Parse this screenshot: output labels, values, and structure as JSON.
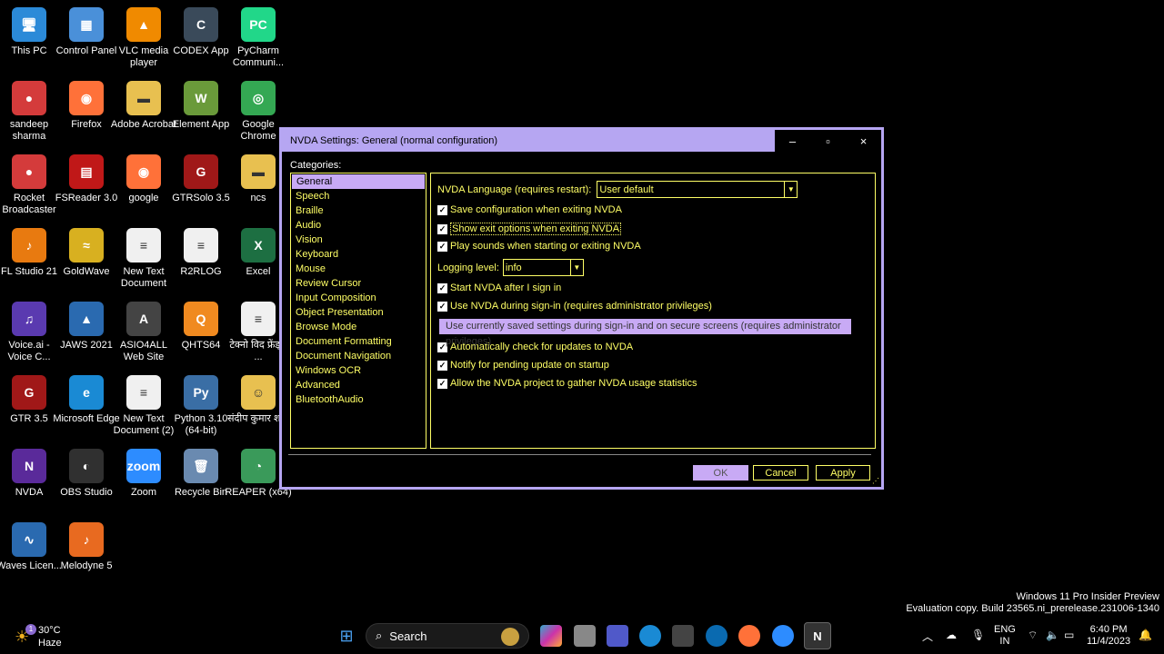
{
  "desktop": {
    "icons": [
      {
        "label": "This PC",
        "icon": "computer-icon",
        "color": "#2b8ad8",
        "glyph": "🖥"
      },
      {
        "label": "Control Panel",
        "icon": "control-panel-icon",
        "color": "#4a90d9",
        "glyph": "▦"
      },
      {
        "label": "VLC media player",
        "icon": "vlc-icon",
        "color": "#f08a00",
        "glyph": "▲"
      },
      {
        "label": "CODEX App",
        "icon": "codex-icon",
        "color": "#3a4a5a",
        "glyph": "C"
      },
      {
        "label": "PyCharm Communi...",
        "icon": "pycharm-icon",
        "color": "#21d789",
        "glyph": "PC"
      },
      {
        "label": "sandeep sharma",
        "icon": "microphone-icon",
        "color": "#d43b3b",
        "glyph": "●"
      },
      {
        "label": "Firefox",
        "icon": "firefox-icon",
        "color": "#ff7139",
        "glyph": "◉"
      },
      {
        "label": "Adobe Acrobat",
        "icon": "folder-icon",
        "color": "#e8c050",
        "glyph": "▬"
      },
      {
        "label": "Element App",
        "icon": "element-icon",
        "color": "#6a9a3a",
        "glyph": "W"
      },
      {
        "label": "Google Chrome",
        "icon": "chrome-icon",
        "color": "#34a853",
        "glyph": "◎"
      },
      {
        "label": "Rocket Broadcaster",
        "icon": "microphone-icon",
        "color": "#d43b3b",
        "glyph": "●"
      },
      {
        "label": "FSReader 3.0",
        "icon": "book-icon",
        "color": "#c01818",
        "glyph": "▤"
      },
      {
        "label": "google",
        "icon": "firefox-icon",
        "color": "#ff7139",
        "glyph": "◉"
      },
      {
        "label": "GTRSolo 3.5",
        "icon": "gtr-icon",
        "color": "#a01818",
        "glyph": "G"
      },
      {
        "label": "ncs",
        "icon": "folder-icon",
        "color": "#e8c050",
        "glyph": "▬"
      },
      {
        "label": "FL Studio 21",
        "icon": "fl-studio-icon",
        "color": "#e87a10",
        "glyph": "♪"
      },
      {
        "label": "GoldWave",
        "icon": "goldwave-icon",
        "color": "#d8b020",
        "glyph": "≈"
      },
      {
        "label": "New Text Document",
        "icon": "text-document-icon",
        "color": "#f0f0f0",
        "glyph": "≡"
      },
      {
        "label": "R2RLOG",
        "icon": "text-document-icon",
        "color": "#f0f0f0",
        "glyph": "≡"
      },
      {
        "label": "Excel",
        "icon": "excel-icon",
        "color": "#1d6f42",
        "glyph": "X"
      },
      {
        "label": "Voice.ai - Voice C...",
        "icon": "voice-ai-icon",
        "color": "#5a3ab0",
        "glyph": "♫"
      },
      {
        "label": "JAWS 2021",
        "icon": "jaws-icon",
        "color": "#2a6ab0",
        "glyph": "▲"
      },
      {
        "label": "ASIO4ALL Web Site",
        "icon": "asio-icon",
        "color": "#444",
        "glyph": "A"
      },
      {
        "label": "QHTS64",
        "icon": "qhts-icon",
        "color": "#f08a20",
        "glyph": "Q"
      },
      {
        "label": "टेक्नो विद फ्रेंड्स ...",
        "icon": "text-document-icon",
        "color": "#f0f0f0",
        "glyph": "≡"
      },
      {
        "label": "GTR 3.5",
        "icon": "gtr-icon",
        "color": "#a01818",
        "glyph": "G"
      },
      {
        "label": "Microsoft Edge",
        "icon": "edge-icon",
        "color": "#1a8ad4",
        "glyph": "e"
      },
      {
        "label": "New Text Document (2)",
        "icon": "text-document-icon",
        "color": "#f0f0f0",
        "glyph": "≡"
      },
      {
        "label": "Python 3.10 (64-bit)",
        "icon": "python-icon",
        "color": "#3a6ea5",
        "glyph": "Py"
      },
      {
        "label": "संदीप कुमार शर्मा",
        "icon": "user-folder-icon",
        "color": "#e8c050",
        "glyph": "☺"
      },
      {
        "label": "NVDA",
        "icon": "nvda-icon",
        "color": "#5a2a9a",
        "glyph": "N"
      },
      {
        "label": "OBS Studio",
        "icon": "obs-icon",
        "color": "#303030",
        "glyph": "◐"
      },
      {
        "label": "Zoom",
        "icon": "zoom-icon",
        "color": "#2d8cff",
        "glyph": "zoom"
      },
      {
        "label": "Recycle Bin",
        "icon": "recycle-bin-icon",
        "color": "#6a8ab0",
        "glyph": "🗑"
      },
      {
        "label": "REAPER (x64)",
        "icon": "reaper-icon",
        "color": "#3a9a5a",
        "glyph": "◔"
      },
      {
        "label": "Waves Licen...",
        "icon": "waves-icon",
        "color": "#2a6ab0",
        "glyph": "∿"
      },
      {
        "label": "Melodyne 5",
        "icon": "melodyne-icon",
        "color": "#e86a20",
        "glyph": "♪"
      }
    ]
  },
  "dialog": {
    "title": "NVDA Settings: General (normal configuration)",
    "minimize": "–",
    "maximize": "▫",
    "close": "×",
    "categories_label": "Categories:",
    "categories": [
      "General",
      "Speech",
      "Braille",
      "Audio",
      "Vision",
      "Keyboard",
      "Mouse",
      "Review Cursor",
      "Input Composition",
      "Object Presentation",
      "Browse Mode",
      "Document Formatting",
      "Document Navigation",
      "Windows OCR",
      "Advanced",
      "BluetoothAudio"
    ],
    "selected_category": "General",
    "language_label": "NVDA Language (requires restart):",
    "language_value": "User default",
    "checkbox_save": "Save configuration when exiting NVDA",
    "checkbox_exit_options": "Show exit options when exiting NVDA",
    "checkbox_sounds": "Play sounds when starting or exiting NVDA",
    "logging_label": "Logging level:",
    "logging_value": "info",
    "checkbox_start_after_signin": "Start NVDA after I sign in",
    "checkbox_use_during_signin": "Use NVDA during sign-in (requires administrator privileges)",
    "button_use_saved": "Use currently saved settings during sign-in and on secure screens (requires administrator privileges)",
    "checkbox_auto_update": "Automatically check for updates to NVDA",
    "checkbox_notify_update": "Notify for pending update on startup",
    "checkbox_usage_stats": "Allow the NVDA project to gather NVDA usage statistics",
    "ok": "OK",
    "cancel": "Cancel",
    "apply": "Apply"
  },
  "watermark": {
    "line1": "Windows 11 Pro Insider Preview",
    "line2": "Evaluation copy. Build 23565.ni_prerelease.231006-1340"
  },
  "taskbar": {
    "weather_temp": "30°C",
    "weather_desc": "Haze",
    "weather_badge": "1",
    "search_label": "Search",
    "lang_line1": "ENG",
    "lang_line2": "IN",
    "time": "6:40 PM",
    "date": "11/4/2023"
  },
  "colors": {
    "accent": "#b6a6f2",
    "highlight": "#c8aaf5",
    "text_yellow": "#ffff66"
  }
}
